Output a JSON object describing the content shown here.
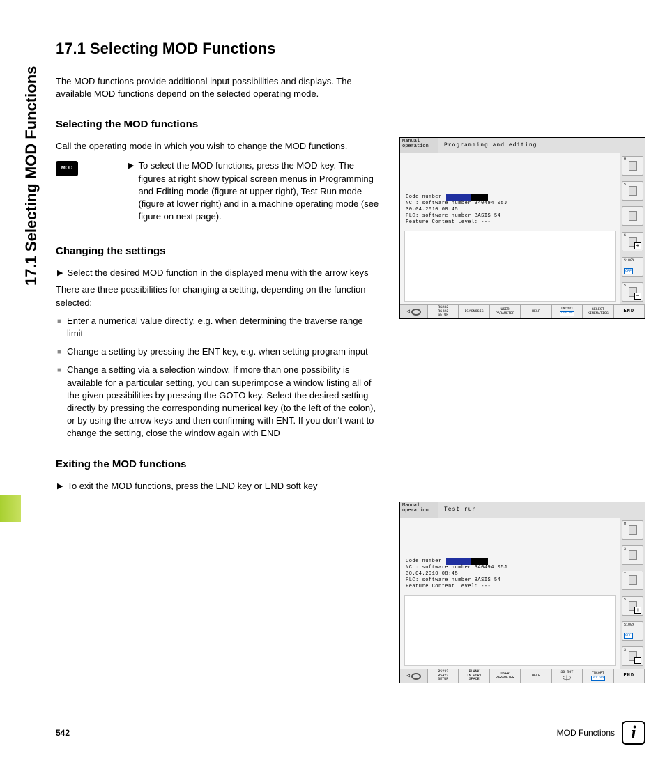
{
  "sideTitle": "17.1 Selecting MOD Functions",
  "title": "17.1  Selecting MOD Functions",
  "intro": "The MOD functions provide additional input possibilities and displays. The available MOD functions depend on the selected operating mode.",
  "h_select": "Selecting the MOD functions",
  "p_select": "Call the operating mode in which you wish to change the MOD functions.",
  "modKey": "MOD",
  "modBullet": "To select the MOD functions, press the MOD key. The figures at right show typical screen menus in Programming and Editing mode (figure at upper right), Test Run mode (figure at lower right) and in a machine operating mode (see figure on next page).",
  "h_change": "Changing the settings",
  "changeBullet": "Select the desired MOD function in the displayed menu with the arrow keys",
  "p_change": "There are three possibilities for changing a setting, depending on the function selected:",
  "sqItems": [
    "Enter a numerical value directly, e.g. when determining the traverse range limit",
    "Change a setting by pressing the ENT key, e.g. when setting program input",
    "Change a setting via a selection window. If more than one possibility is available for a particular setting, you can superimpose a window listing all of the given possibilities by pressing the GOTO key. Select the desired setting directly by pressing the corresponding numerical key (to the left of the colon), or by using the arrow keys and then confirming with ENT. If you don't want to change the setting, close the window again with END"
  ],
  "h_exit": "Exiting the MOD functions",
  "exitBullet": "To exit the MOD functions, press the END key or END soft key",
  "screen1": {
    "corner": "Manual operation",
    "title": "Programming and editing",
    "codeLabel": "Code number",
    "lines": [
      "NC : software number   340494 05J",
      "     30.04.2010 08:45",
      "PLC: software number   BASIS 54",
      "Feature Content Level: ---"
    ],
    "side": [
      "M",
      "S",
      "T",
      "S",
      "S100%",
      "S"
    ],
    "offLabel": "OFF",
    "soft": [
      {
        "t": "RS232\nRS422\nSETUP"
      },
      {
        "t": "DIAGNOSIS"
      },
      {
        "t": "USER\nPARAMETER"
      },
      {
        "t": "HELP"
      },
      {
        "t": "TNCOPT",
        "b": "OFF   ON"
      },
      {
        "t": "SELECT\nKINEMATICS"
      }
    ],
    "end": "END"
  },
  "screen2": {
    "corner": "Manual operation",
    "title": "Test run",
    "codeLabel": "Code number",
    "lines": [
      "NC : software number   340494 05J",
      "     30.04.2010 08:45",
      "PLC: software number   BASIS 54",
      "Feature Content Level: ---"
    ],
    "side": [
      "M",
      "S",
      "T",
      "S",
      "S100%",
      "S"
    ],
    "offLabel": "OFF",
    "soft": [
      {
        "t": "RS232\nRS422\nSETUP"
      },
      {
        "t": "BLANK\nIN WORK\nSPACE"
      },
      {
        "t": "USER\nPARAMETER"
      },
      {
        "t": "HELP"
      },
      {
        "t": "3D ROT",
        "ico": true
      },
      {
        "t": "TNCOPT",
        "b": "OFF   ON"
      }
    ],
    "end": "END"
  },
  "footer": {
    "page": "542",
    "chapter": "MOD Functions"
  }
}
